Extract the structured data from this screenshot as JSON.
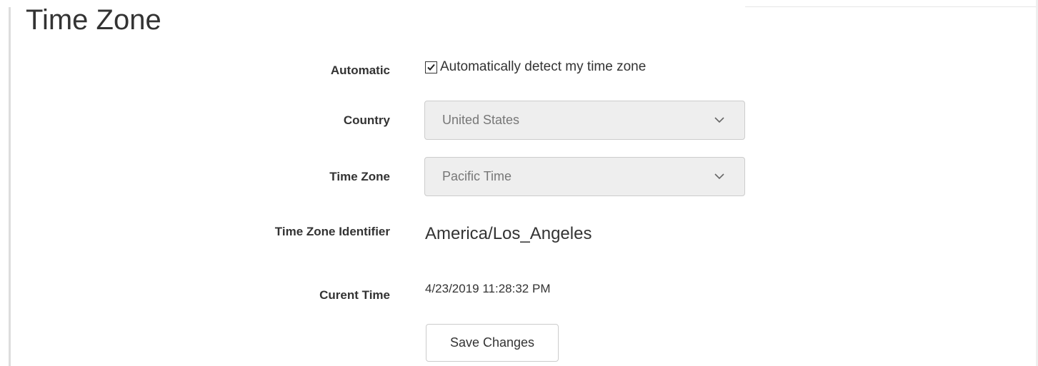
{
  "page": {
    "title": "Time Zone"
  },
  "form": {
    "automatic": {
      "label": "Automatic",
      "checkbox_label": "Automatically detect my time zone",
      "checked": true
    },
    "country": {
      "label": "Country",
      "selected": "United States",
      "icon": "chevron-down-icon",
      "disabled": true
    },
    "time_zone": {
      "label": "Time Zone",
      "selected": "Pacific Time",
      "icon": "chevron-down-icon",
      "disabled": true
    },
    "identifier": {
      "label": "Time Zone Identifier",
      "value": "America/Los_Angeles"
    },
    "current_time": {
      "label": "Curent Time",
      "value": "4/23/2019 11:28:32 PM"
    },
    "save_label": "Save Changes"
  },
  "colors": {
    "text": "#333333",
    "select_bg": "#eeeeee",
    "select_text": "#777777",
    "border": "#cccccc"
  }
}
